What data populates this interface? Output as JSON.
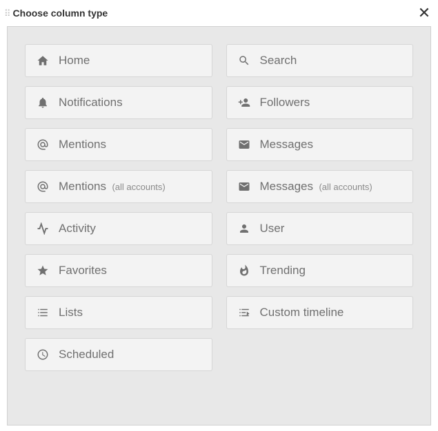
{
  "header": {
    "title": "Choose column type"
  },
  "options": {
    "home": {
      "label": "Home"
    },
    "search": {
      "label": "Search"
    },
    "notifications": {
      "label": "Notifications"
    },
    "followers": {
      "label": "Followers"
    },
    "mentions": {
      "label": "Mentions"
    },
    "messages": {
      "label": "Messages"
    },
    "mentions_all": {
      "label": "Mentions",
      "sub": "(all accounts)"
    },
    "messages_all": {
      "label": "Messages",
      "sub": "(all accounts)"
    },
    "activity": {
      "label": "Activity"
    },
    "user": {
      "label": "User"
    },
    "favorites": {
      "label": "Favorites"
    },
    "trending": {
      "label": "Trending"
    },
    "lists": {
      "label": "Lists"
    },
    "custom_timeline": {
      "label": "Custom timeline"
    },
    "scheduled": {
      "label": "Scheduled"
    }
  }
}
